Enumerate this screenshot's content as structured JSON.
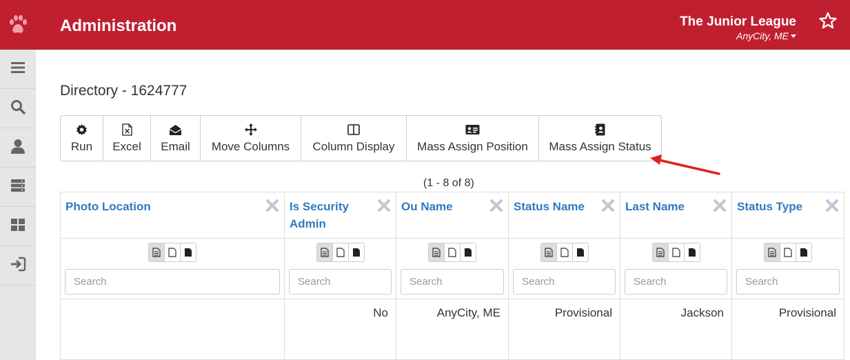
{
  "header": {
    "logo_icon": "paw-icon",
    "app_title": "Administration",
    "org_name": "The Junior League",
    "org_city": "AnyCity, ME",
    "favorite_icon": "star-outline-icon",
    "background": "#c01f2f"
  },
  "sidebar": {
    "items": [
      {
        "icon": "menu-icon"
      },
      {
        "icon": "search-icon"
      },
      {
        "icon": "user-icon"
      },
      {
        "icon": "server-icon"
      },
      {
        "icon": "dashboard-icon"
      },
      {
        "icon": "sign-in-icon"
      }
    ]
  },
  "page": {
    "title": "Directory - 1624777"
  },
  "toolbar": {
    "buttons": [
      {
        "label": "Run",
        "icon": "gear-icon"
      },
      {
        "label": "Excel",
        "icon": "excel-file-icon"
      },
      {
        "label": "Email",
        "icon": "envelope-open-icon"
      },
      {
        "label": "Move Columns",
        "icon": "move-arrows-icon"
      },
      {
        "label": "Column Display",
        "icon": "columns-icon"
      },
      {
        "label": "Mass Assign Position",
        "icon": "id-card-icon"
      },
      {
        "label": "Mass Assign Status",
        "icon": "contact-book-icon"
      }
    ]
  },
  "grid": {
    "range_text": "(1 - 8 of 8)",
    "header_color": "#2f7ac0",
    "search_placeholder": "Search",
    "columns": [
      {
        "label": "Photo Location"
      },
      {
        "label": "Is Security Admin"
      },
      {
        "label": "Ou Name"
      },
      {
        "label": "Status Name"
      },
      {
        "label": "Last Name"
      },
      {
        "label": "Status Type"
      }
    ],
    "rows": [
      [
        "",
        "No",
        "AnyCity, ME",
        "Provisional",
        "Jackson",
        "Provisional"
      ]
    ]
  }
}
